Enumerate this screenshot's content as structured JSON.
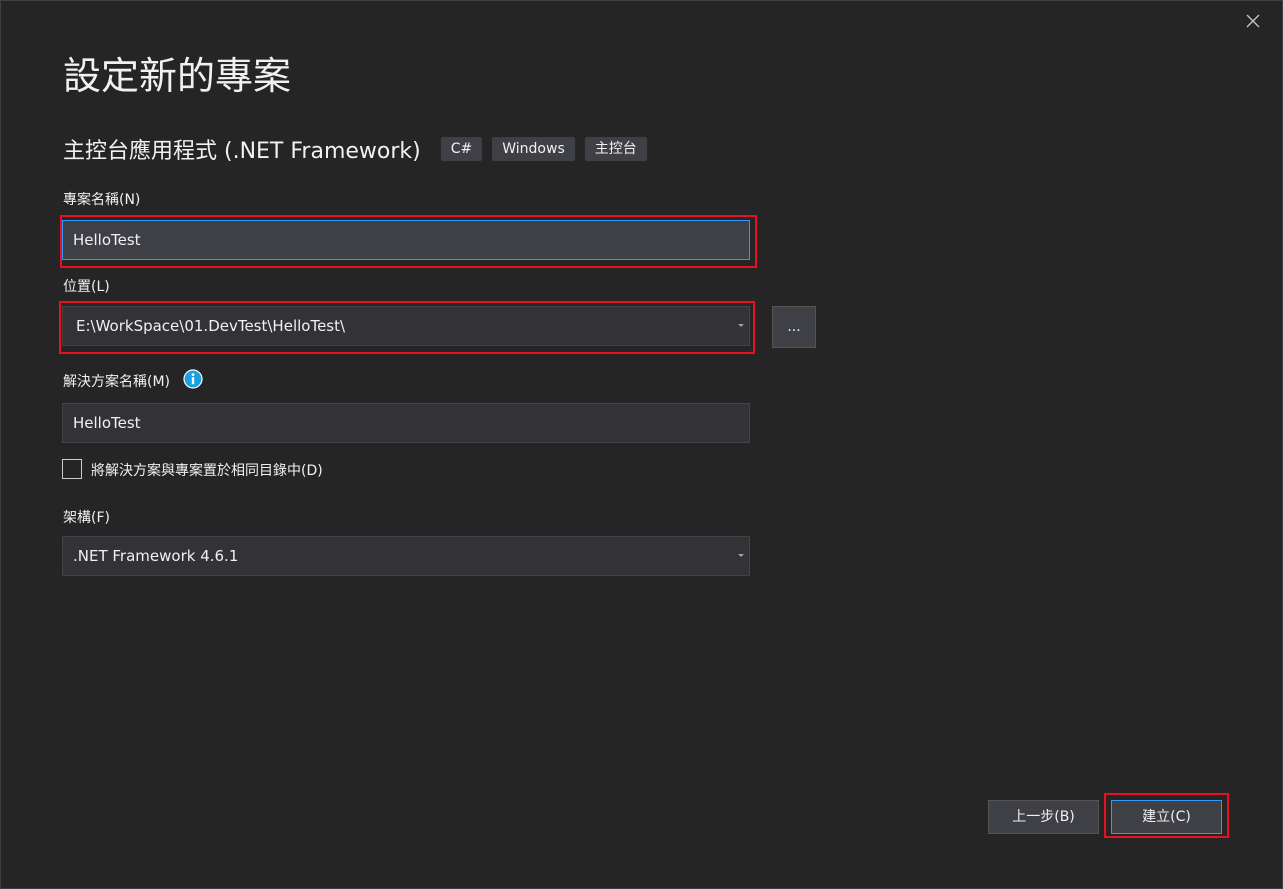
{
  "dialog": {
    "title": "設定新的專案",
    "close_icon": "close-icon"
  },
  "template": {
    "name": "主控台應用程式 (.NET Framework)",
    "tags": [
      "C#",
      "Windows",
      "主控台"
    ]
  },
  "project_name": {
    "label": "專案名稱(N)",
    "value": "HelloTest"
  },
  "location": {
    "label": "位置(L)",
    "value": "E:\\WorkSpace\\01.DevTest\\HelloTest\\",
    "browse_label": "..."
  },
  "solution_name": {
    "label": "解決方案名稱(M)",
    "value": "HelloTest",
    "info_icon": "info-icon"
  },
  "same_dir": {
    "label": "將解決方案與專案置於相同目錄中(D)",
    "checked": false
  },
  "framework": {
    "label": "架構(F)",
    "value": ".NET Framework 4.6.1"
  },
  "buttons": {
    "back_label": "上一步(B)",
    "create_label": "建立(C)"
  },
  "colors": {
    "background": "#252526",
    "input_bg": "#333337",
    "accent": "#3399ff",
    "highlight": "#e81123",
    "info": "#1ba1e2"
  }
}
